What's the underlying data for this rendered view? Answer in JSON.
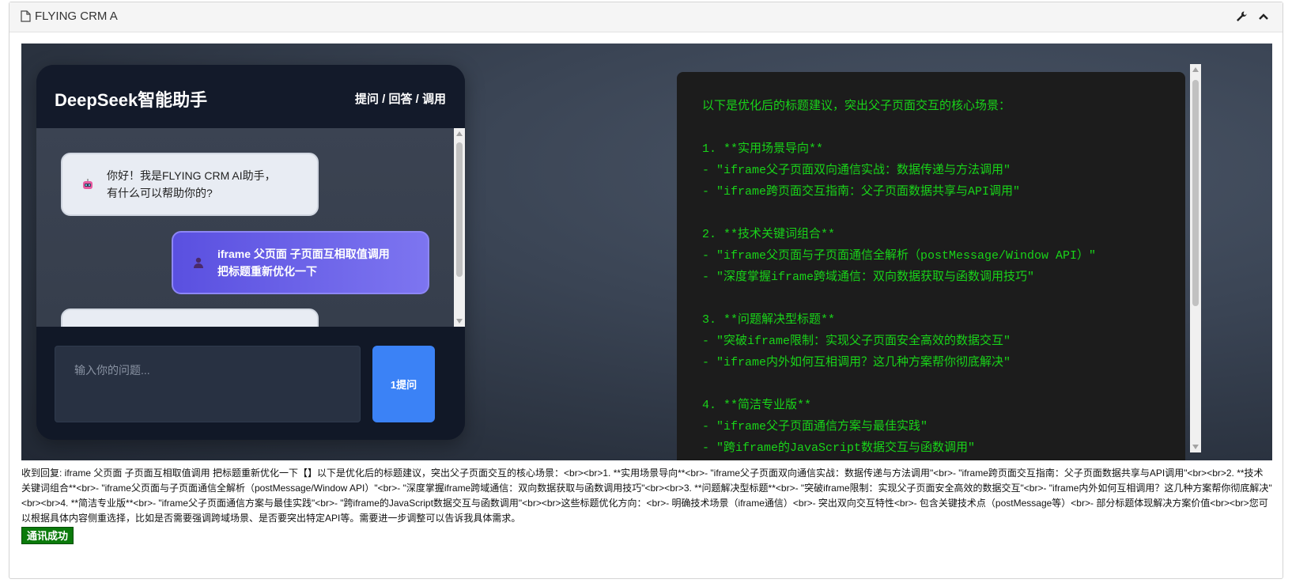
{
  "panel": {
    "title": "FLYING CRM A"
  },
  "chat": {
    "title": "DeepSeek智能助手",
    "tabs": "提问 / 回答 / 调用",
    "messages": [
      {
        "role": "bot",
        "line1": "你好！我是FLYING CRM AI助手，",
        "line2": "有什么可以帮助你的?"
      },
      {
        "role": "user",
        "line1": "iframe 父页面 子页面互相取值调用",
        "line2": "把标题重新优化一下"
      }
    ],
    "input_placeholder": "输入你的问题...",
    "ask_button": "1提问"
  },
  "terminal": {
    "text": "以下是优化后的标题建议，突出父子页面交互的核心场景：\n\n1. **实用场景导向**\n- \"iframe父子页面双向通信实战：数据传递与方法调用\"\n- \"iframe跨页面交互指南：父子页面数据共享与API调用\"\n\n2. **技术关键词组合**\n- \"iframe父页面与子页面通信全解析（postMessage/Window API）\"\n- \"深度掌握iframe跨域通信：双向数据获取与函数调用技巧\"\n\n3. **问题解决型标题**\n- \"突破iframe限制：实现父子页面安全高效的数据交互\"\n- \"iframe内外如何互相调用？这几种方案帮你彻底解决\"\n\n4. **简洁专业版**\n- \"iframe父子页面通信方案与最佳实践\"\n- \"跨iframe的JavaScript数据交互与函数调用\""
  },
  "result": {
    "text": "收到回复: iframe 父页面 子页面互相取值调用 把标题重新优化一下【】以下是优化后的标题建议，突出父子页面交互的核心场景：<br><br>1. **实用场景导向**<br>- \"iframe父子页面双向通信实战：数据传递与方法调用\"<br>- \"iframe跨页面交互指南：父子页面数据共享与API调用\"<br><br>2. **技术关键词组合**<br>- \"iframe父页面与子页面通信全解析（postMessage/Window API）\"<br>- \"深度掌握iframe跨域通信：双向数据获取与函数调用技巧\"<br><br>3. **问题解决型标题**<br>- \"突破iframe限制：实现父子页面安全高效的数据交互\"<br>- \"iframe内外如何互相调用？这几种方案帮你彻底解决\"<br><br>4. **简洁专业版**<br>- \"iframe父子页面通信方案与最佳实践\"<br>- \"跨iframe的JavaScript数据交互与函数调用\"<br><br>这些标题优化方向：<br>- 明确技术场景（iframe通信）<br>- 突出双向交互特性<br>- 包含关键技术点（postMessage等）<br>- 部分标题体现解决方案价值<br><br>您可以根据具体内容侧重选择，比如是否需要强调跨域场景、是否要突出特定API等。需要进一步调整可以告诉我具体需求。",
    "status": "通讯成功"
  },
  "colors": {
    "terminal_text": "#19d419",
    "ask_button": "#3b82f6",
    "status_badge": "#0b7a0b"
  },
  "icons": {
    "panel": "document-icon",
    "tools": [
      "wrench-icon",
      "chevron-up-icon"
    ],
    "bot_avatar": "robot-icon",
    "user_avatar": "user-icon"
  }
}
